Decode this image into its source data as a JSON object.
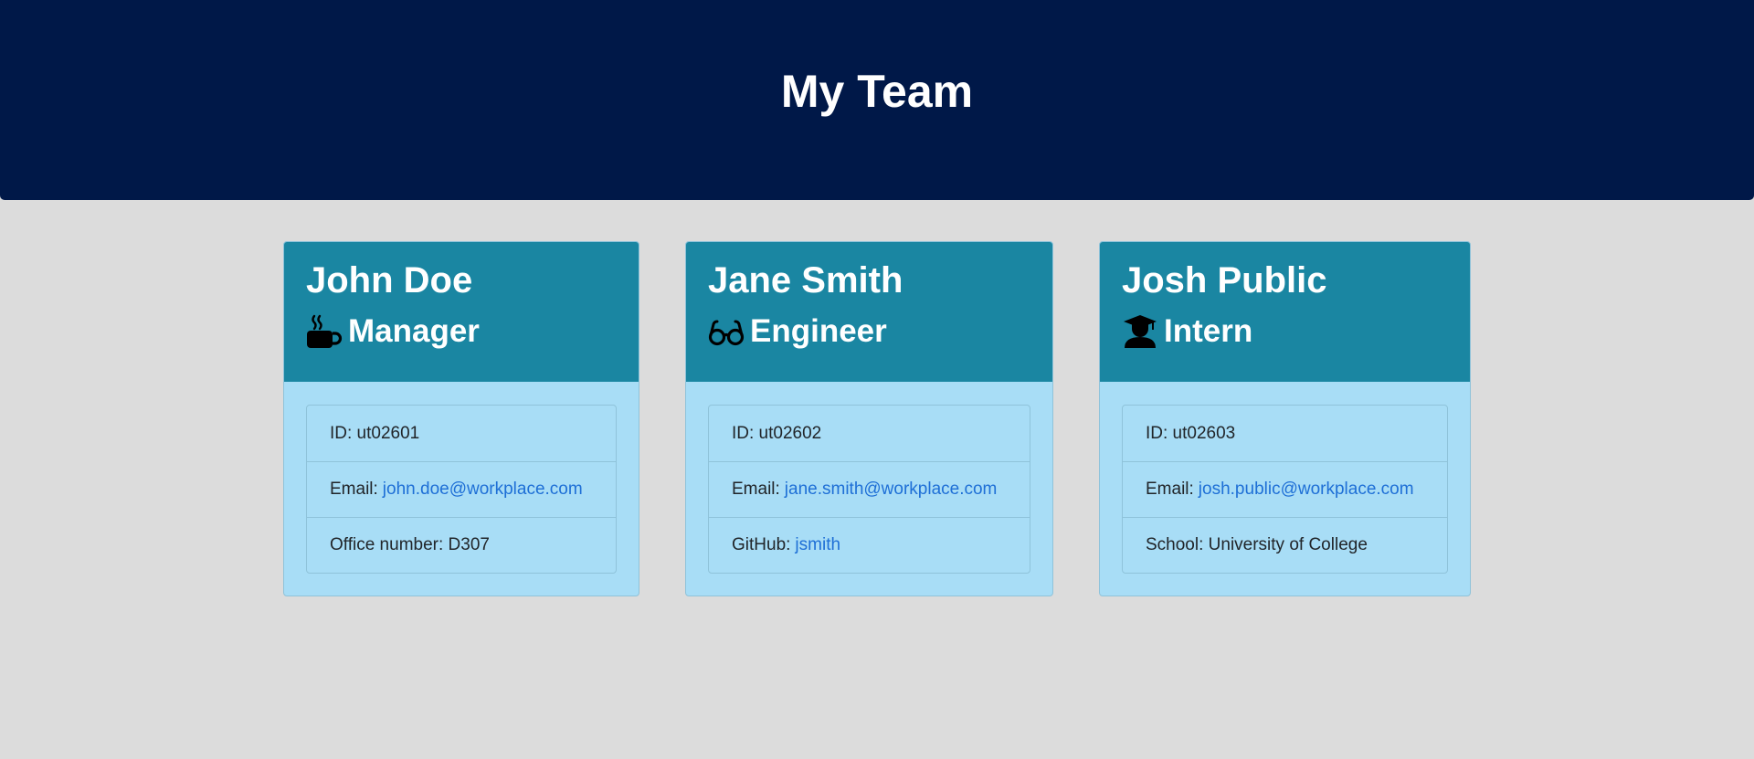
{
  "header": {
    "title": "My Team"
  },
  "cards": [
    {
      "name": "John Doe",
      "role": "Manager",
      "role_icon": "coffee-icon",
      "id_text": "ID: ut02601",
      "email_label": "Email:",
      "email": "john.doe@workplace.com",
      "extra_label": "Office number: D307",
      "extra_value": ""
    },
    {
      "name": "Jane Smith",
      "role": "Engineer",
      "role_icon": "glasses-icon",
      "id_text": "ID: ut02602",
      "email_label": "Email:",
      "email": "jane.smith@workplace.com",
      "extra_label": "GitHub:",
      "extra_value": "jsmith"
    },
    {
      "name": "Josh Public",
      "role": "Intern",
      "role_icon": "graduate-icon",
      "id_text": "ID: ut02603",
      "email_label": "Email:",
      "email": "josh.public@workplace.com",
      "extra_label": "School: University of College",
      "extra_value": ""
    }
  ],
  "colors": {
    "header_bg": "#001848",
    "page_bg": "#dcdcdc",
    "card_head_bg": "#1a86a2",
    "card_body_bg": "#a8ddf6",
    "link": "#1e6fd6"
  }
}
